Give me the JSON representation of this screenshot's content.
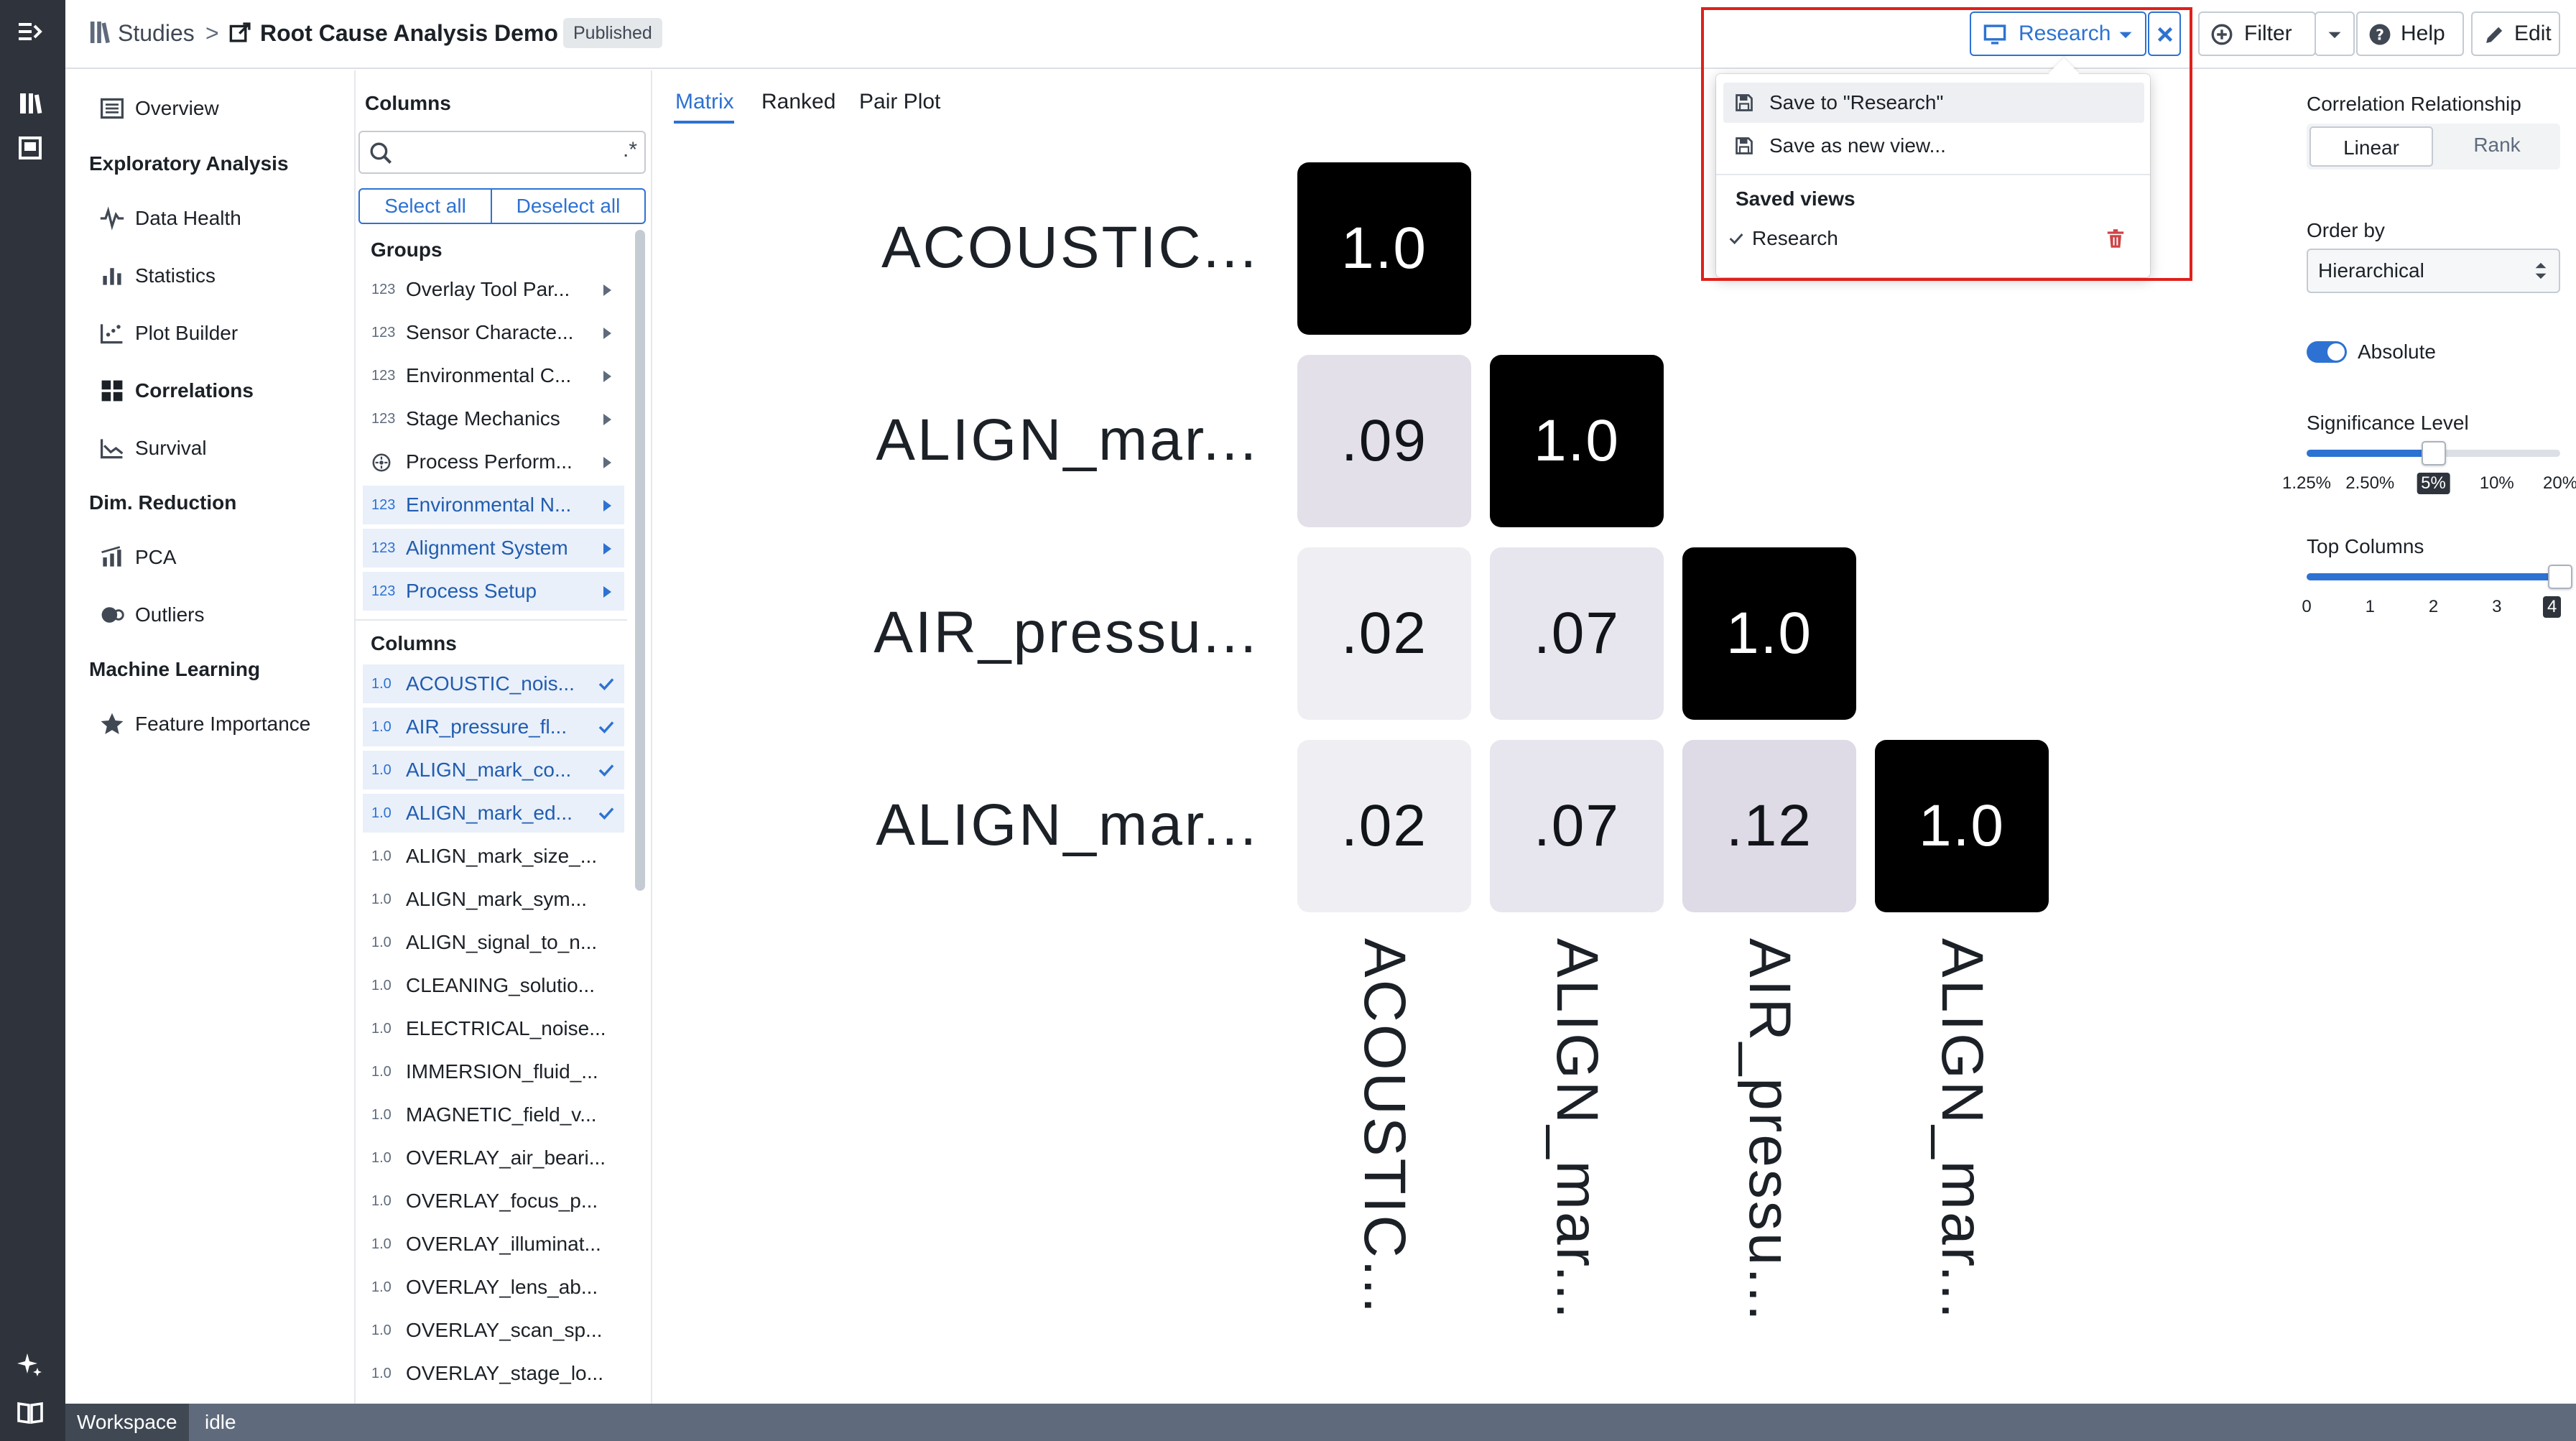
{
  "breadcrumb": {
    "root": "Studies",
    "separator": ">",
    "title": "Root Cause Analysis Demo",
    "status": "Published"
  },
  "toolbar": {
    "view_button": "Research",
    "filter_label": "Filter",
    "help_label": "Help",
    "edit_label": "Edit"
  },
  "view_menu": {
    "save_to": "Save to \"Research\"",
    "save_new": "Save as new view...",
    "section_title": "Saved views",
    "saved_views": [
      "Research"
    ]
  },
  "nav": {
    "overview": "Overview",
    "section_exploratory": "Exploratory Analysis",
    "data_health": "Data Health",
    "statistics": "Statistics",
    "plot_builder": "Plot Builder",
    "correlations": "Correlations",
    "survival": "Survival",
    "section_dim": "Dim. Reduction",
    "pca": "PCA",
    "outliers": "Outliers",
    "section_ml": "Machine Learning",
    "feature_importance": "Feature Importance"
  },
  "columns_panel": {
    "title": "Columns",
    "search_placeholder": "",
    "regex_toggle": ".*",
    "select_all": "Select all",
    "deselect_all": "Deselect all",
    "groups_title": "Groups",
    "groups": [
      {
        "type": "123",
        "label": "Overlay Tool Par...",
        "selected": false
      },
      {
        "type": "123",
        "label": "Sensor Characte...",
        "selected": false
      },
      {
        "type": "123",
        "label": "Environmental C...",
        "selected": false
      },
      {
        "type": "123",
        "label": "Stage Mechanics",
        "selected": false
      },
      {
        "type": "",
        "label": "Process Perform...",
        "selected": false
      },
      {
        "type": "123",
        "label": "Environmental N...",
        "selected": true
      },
      {
        "type": "123",
        "label": "Alignment System",
        "selected": true
      },
      {
        "type": "123",
        "label": "Process Setup",
        "selected": true
      }
    ],
    "columns_title": "Columns",
    "columns": [
      {
        "type": "1.0",
        "label": "ACOUSTIC_nois...",
        "selected": true
      },
      {
        "type": "1.0",
        "label": "AIR_pressure_fl...",
        "selected": true
      },
      {
        "type": "1.0",
        "label": "ALIGN_mark_co...",
        "selected": true
      },
      {
        "type": "1.0",
        "label": "ALIGN_mark_ed...",
        "selected": true
      },
      {
        "type": "1.0",
        "label": "ALIGN_mark_size_...",
        "selected": false
      },
      {
        "type": "1.0",
        "label": "ALIGN_mark_sym...",
        "selected": false
      },
      {
        "type": "1.0",
        "label": "ALIGN_signal_to_n...",
        "selected": false
      },
      {
        "type": "1.0",
        "label": "CLEANING_solutio...",
        "selected": false
      },
      {
        "type": "1.0",
        "label": "ELECTRICAL_noise...",
        "selected": false
      },
      {
        "type": "1.0",
        "label": "IMMERSION_fluid_...",
        "selected": false
      },
      {
        "type": "1.0",
        "label": "MAGNETIC_field_v...",
        "selected": false
      },
      {
        "type": "1.0",
        "label": "OVERLAY_air_beari...",
        "selected": false
      },
      {
        "type": "1.0",
        "label": "OVERLAY_focus_p...",
        "selected": false
      },
      {
        "type": "1.0",
        "label": "OVERLAY_illuminat...",
        "selected": false
      },
      {
        "type": "1.0",
        "label": "OVERLAY_lens_ab...",
        "selected": false
      },
      {
        "type": "1.0",
        "label": "OVERLAY_scan_sp...",
        "selected": false
      },
      {
        "type": "1.0",
        "label": "OVERLAY_stage_lo...",
        "selected": false
      }
    ]
  },
  "tabs": [
    "Matrix",
    "Ranked",
    "Pair Plot"
  ],
  "matrix": {
    "row_labels": [
      "ACOUSTIC...",
      "ALIGN_mar...",
      "AIR_pressu...",
      "ALIGN_mar..."
    ],
    "col_labels": [
      "ACOUSTIC...",
      "ALIGN_mar...",
      "AIR_pressu...",
      "ALIGN_mar..."
    ],
    "cells": [
      [
        {
          "label": "1.0",
          "value": 1.0
        }
      ],
      [
        {
          "label": ".09",
          "value": 0.09
        },
        {
          "label": "1.0",
          "value": 1.0
        }
      ],
      [
        {
          "label": ".02",
          "value": 0.02
        },
        {
          "label": ".07",
          "value": 0.07
        },
        {
          "label": "1.0",
          "value": 1.0
        }
      ],
      [
        {
          "label": ".02",
          "value": 0.02
        },
        {
          "label": ".07",
          "value": 0.07
        },
        {
          "label": ".12",
          "value": 0.12
        },
        {
          "label": "1.0",
          "value": 1.0
        }
      ]
    ]
  },
  "settings": {
    "relationship_label": "Correlation Relationship",
    "linear": "Linear",
    "rank": "Rank",
    "order_label": "Order by",
    "order_value": "Hierarchical",
    "absolute_label": "Absolute",
    "absolute_on": true,
    "significance_label": "Significance Level",
    "significance_ticks": [
      "1.25%",
      "2.50%",
      "5%",
      "10%",
      "20%"
    ],
    "significance_value": "5%",
    "top_label": "Top Columns",
    "top_ticks": [
      "0",
      "1",
      "2",
      "3",
      "4"
    ],
    "top_value": 4
  },
  "status": {
    "workspace": "Workspace",
    "state": "idle"
  },
  "colors": {
    "accent": "#2d72d2",
    "highlight": "#e0201b",
    "rail": "#2f343c",
    "danger": "#cd4246"
  }
}
